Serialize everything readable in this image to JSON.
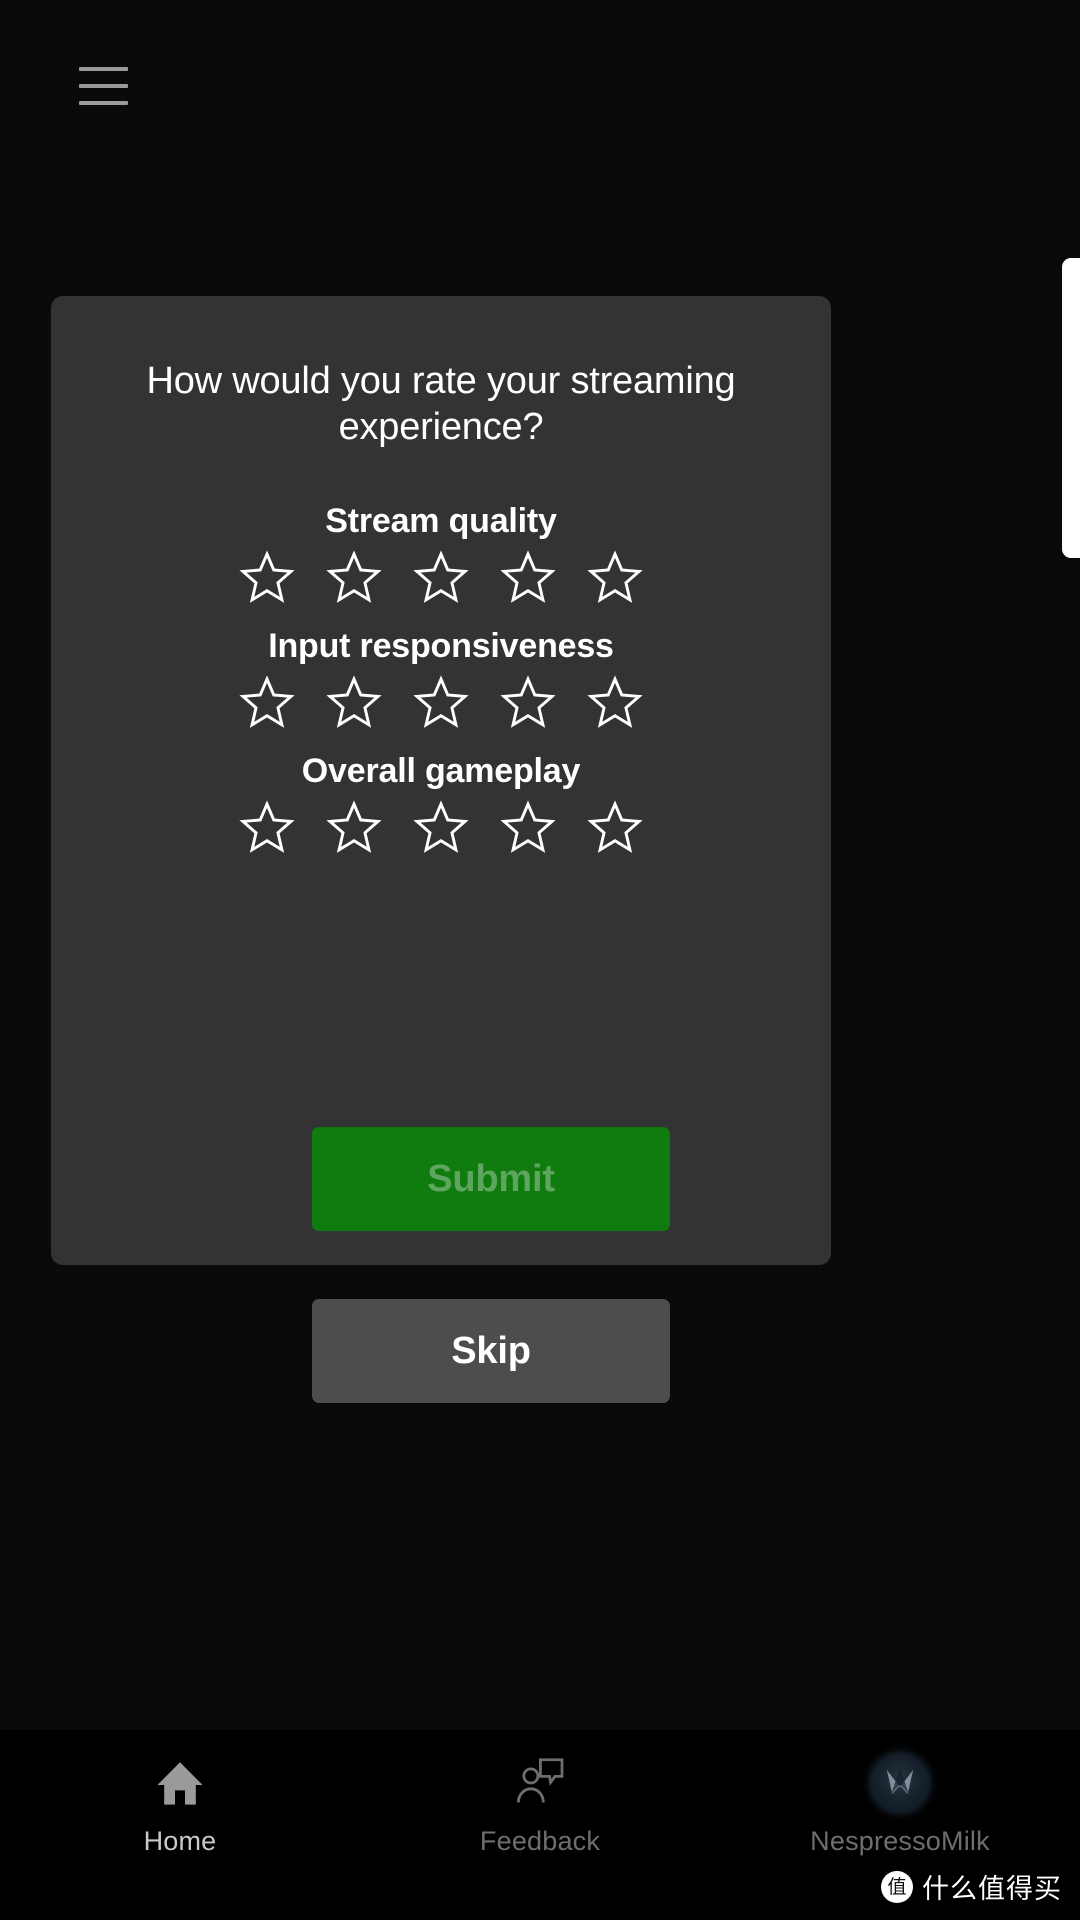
{
  "app": {
    "background_color": "#0a0a0a",
    "card_color": "#333333",
    "accent_green": "#107C10"
  },
  "header": {
    "menu_icon": "hamburger-menu-icon"
  },
  "dialog": {
    "title": "How would you rate your streaming experience?",
    "rating_groups": [
      {
        "id": "stream-quality",
        "label": "Stream quality",
        "stars_total": 5,
        "stars_selected": 0,
        "star_icon": "star-outline-icon"
      },
      {
        "id": "input-responsiveness",
        "label": "Input responsiveness",
        "stars_total": 5,
        "stars_selected": 0,
        "star_icon": "star-outline-icon"
      },
      {
        "id": "overall-gameplay",
        "label": "Overall gameplay",
        "stars_total": 5,
        "stars_selected": 0,
        "star_icon": "star-outline-icon"
      }
    ],
    "submit_label": "Submit",
    "submit_state": "disabled",
    "skip_label": "Skip"
  },
  "bottom_nav": {
    "items": [
      {
        "id": "home",
        "label": "Home",
        "icon": "home-icon",
        "active": true
      },
      {
        "id": "feedback",
        "label": "Feedback",
        "icon": "feedback-person-speech-icon",
        "active": false
      },
      {
        "id": "profile",
        "label": "NespressoMilk",
        "icon": "profile-avatar-icon",
        "active": false
      }
    ]
  },
  "watermark": {
    "mark": "值",
    "text": "什么值得买"
  }
}
